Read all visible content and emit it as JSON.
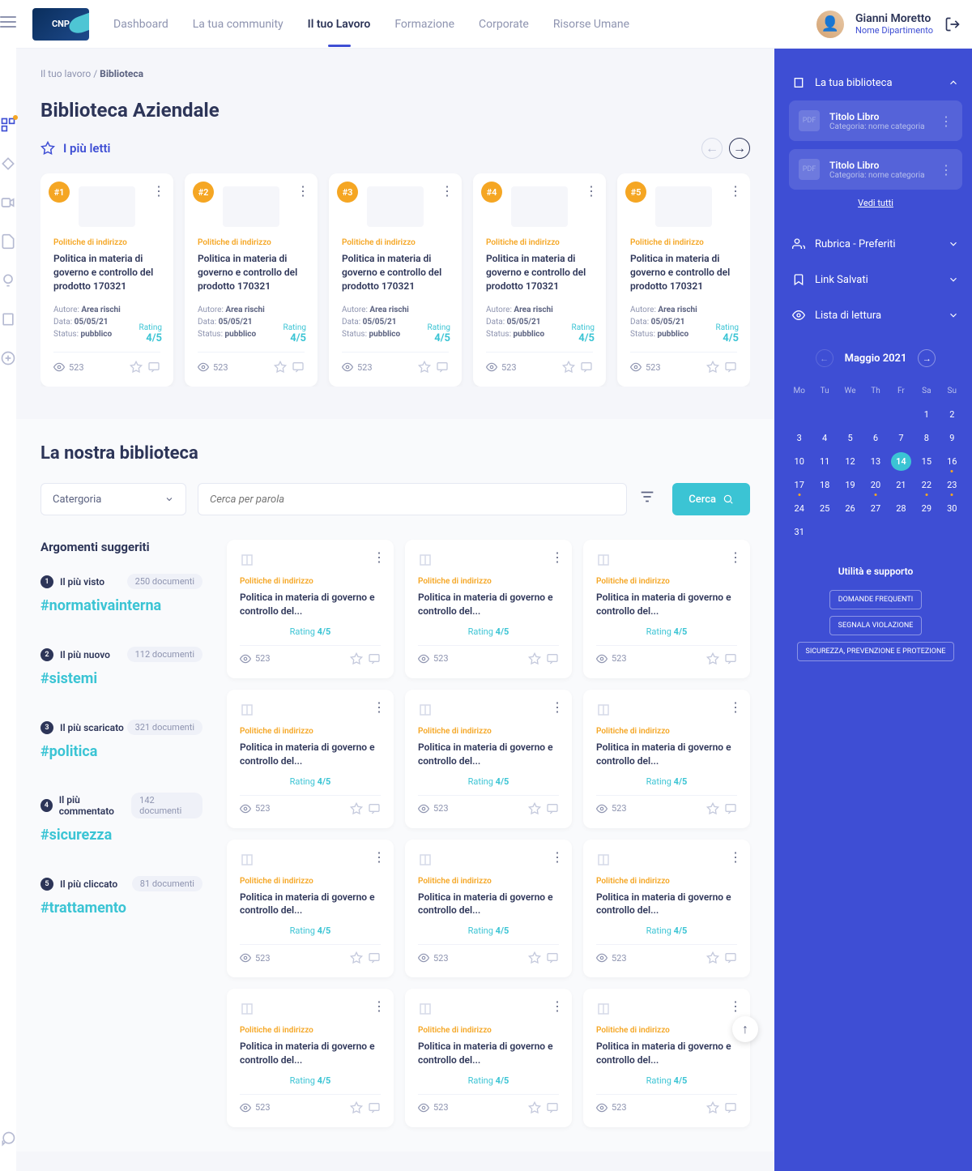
{
  "nav": {
    "items": [
      "Dashboard",
      "La tua community",
      "Il tuo Lavoro",
      "Formazione",
      "Corporate",
      "Risorse Umane"
    ],
    "activeIndex": 2
  },
  "user": {
    "name": "Gianni Moretto",
    "dept": "Nome Dipartimento"
  },
  "breadcrumb": {
    "parent": "Il tuo lavoro",
    "current": "Biblioteca"
  },
  "pageTitle": "Biblioteca Aziendale",
  "mostRead": {
    "label": "I più letti",
    "cards": [
      {
        "rank": "#1",
        "cat": "Politiche di indirizzo",
        "title": "Politica in materia di governo e controllo del prodotto 170321",
        "author": "Area rischi",
        "date": "05/05/21",
        "status": "pubblico",
        "rating": "4/5",
        "views": "523"
      },
      {
        "rank": "#2",
        "cat": "Politiche di indirizzo",
        "title": "Politica in materia di governo e controllo del prodotto 170321",
        "author": "Area rischi",
        "date": "05/05/21",
        "status": "pubblico",
        "rating": "4/5",
        "views": "523"
      },
      {
        "rank": "#3",
        "cat": "Politiche di indirizzo",
        "title": "Politica in materia di governo e controllo del prodotto 170321",
        "author": "Area rischi",
        "date": "05/05/21",
        "status": "pubblico",
        "rating": "4/5",
        "views": "523"
      },
      {
        "rank": "#4",
        "cat": "Politiche di indirizzo",
        "title": "Politica in materia di governo e controllo del prodotto 170321",
        "author": "Area rischi",
        "date": "05/05/21",
        "status": "pubblico",
        "rating": "4/5",
        "views": "523"
      },
      {
        "rank": "#5",
        "cat": "Politiche di indirizzo",
        "title": "Politica in materia di governo e controllo del prodotto 170321",
        "author": "Area rischi",
        "date": "05/05/21",
        "status": "pubblico",
        "rating": "4/5",
        "views": "523"
      }
    ]
  },
  "lib": {
    "title": "La nostra biblioteca",
    "catLabel": "Catergoria",
    "searchPlaceholder": "Cerca per parola",
    "searchBtn": "Cerca",
    "topicsTitle": "Argomenti suggeriti",
    "topics": [
      {
        "n": "1",
        "label": "Il più visto",
        "count": "250 documenti",
        "tag": "#normativainterna"
      },
      {
        "n": "2",
        "label": "Il più nuovo",
        "count": "112 documenti",
        "tag": "#sistemi"
      },
      {
        "n": "3",
        "label": "Il più scaricato",
        "count": "321 documenti",
        "tag": "#politica"
      },
      {
        "n": "4",
        "label": "Il più commentato",
        "count": "142 documenti",
        "tag": "#sicurezza"
      },
      {
        "n": "5",
        "label": "Il più cliccato",
        "count": "81 documenti",
        "tag": "#trattamento"
      }
    ],
    "gridCards": [
      {
        "cat": "Politiche di indirizzo",
        "title": "Politica in materia di governo e controllo del...",
        "rating": "4/5",
        "views": "523"
      },
      {
        "cat": "Politiche di indirizzo",
        "title": "Politica in materia di governo e controllo del...",
        "rating": "4/5",
        "views": "523"
      },
      {
        "cat": "Politiche di indirizzo",
        "title": "Politica in materia di governo e controllo del...",
        "rating": "4/5",
        "views": "523"
      },
      {
        "cat": "Politiche di indirizzo",
        "title": "Politica in materia di governo e controllo del...",
        "rating": "4/5",
        "views": "523"
      },
      {
        "cat": "Politiche di indirizzo",
        "title": "Politica in materia di governo e controllo del...",
        "rating": "4/5",
        "views": "523"
      },
      {
        "cat": "Politiche di indirizzo",
        "title": "Politica in materia di governo e controllo del...",
        "rating": "4/5",
        "views": "523"
      },
      {
        "cat": "Politiche di indirizzo",
        "title": "Politica in materia di governo e controllo del...",
        "rating": "4/5",
        "views": "523"
      },
      {
        "cat": "Politiche di indirizzo",
        "title": "Politica in materia di governo e controllo del...",
        "rating": "4/5",
        "views": "523"
      },
      {
        "cat": "Politiche di indirizzo",
        "title": "Politica in materia di governo e controllo del...",
        "rating": "4/5",
        "views": "523"
      },
      {
        "cat": "Politiche di indirizzo",
        "title": "Politica in materia di governo e controllo del...",
        "rating": "4/5",
        "views": "523"
      },
      {
        "cat": "Politiche di indirizzo",
        "title": "Politica in materia di governo e controllo del...",
        "rating": "4/5",
        "views": "523"
      },
      {
        "cat": "Politiche di indirizzo",
        "title": "Politica in materia di governo e controllo del...",
        "rating": "4/5",
        "views": "523"
      }
    ]
  },
  "sidebar": {
    "lib": {
      "title": "La tua biblioteca",
      "seeAll": "Vedi tutti",
      "books": [
        {
          "title": "Titolo Libro",
          "cat": "Categoria: nome categoria"
        },
        {
          "title": "Titolo Libro",
          "cat": "Categoria: nome categoria"
        }
      ]
    },
    "sections": [
      {
        "label": "Rubrica - Preferiti"
      },
      {
        "label": "Link Salvati"
      },
      {
        "label": "Lista di lettura"
      }
    ],
    "cal": {
      "month": "Maggio 2021",
      "days": [
        "Mo",
        "Tu",
        "We",
        "Th",
        "Fr",
        "Sa",
        "Su"
      ],
      "today": 14,
      "dots": [
        16,
        17,
        20,
        22,
        23
      ]
    },
    "support": {
      "title": "Utilità e supporto",
      "btns": [
        "DOMANDE FREQUENTI",
        "SEGNALA VIOLAZIONE",
        "SICUREZZA, PREVENZIONE E PROTEZIONE"
      ]
    }
  },
  "labels": {
    "author": "Autore:",
    "date": "Data:",
    "status": "Status:",
    "rating": "Rating"
  }
}
